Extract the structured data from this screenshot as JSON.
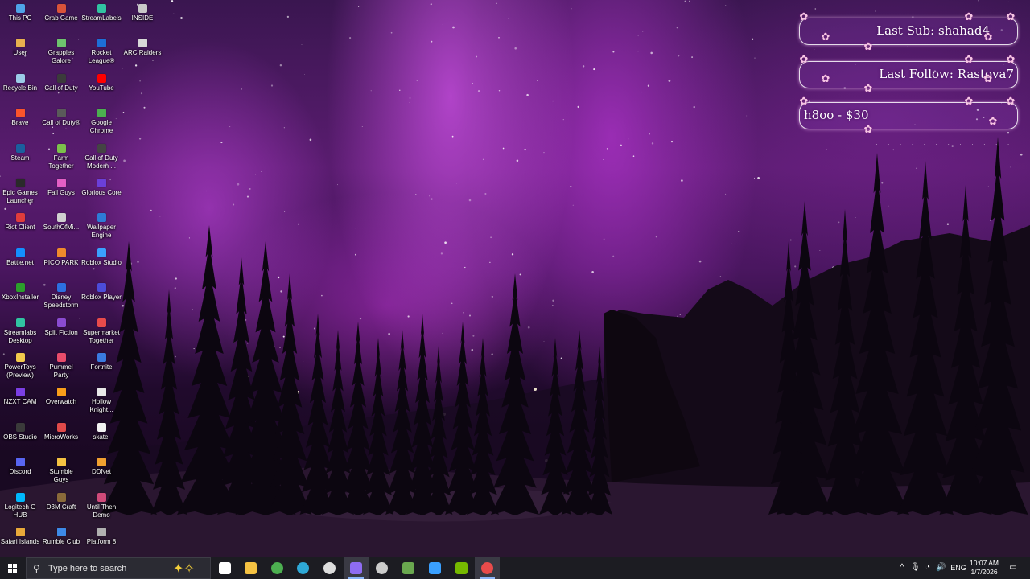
{
  "desktop": {
    "icons": [
      {
        "label": "This PC",
        "color": "#4fa3e8"
      },
      {
        "label": "User",
        "color": "#e8b04f"
      },
      {
        "label": "Recycle Bin",
        "color": "#9ccbe8"
      },
      {
        "label": "Brave",
        "color": "#fb542b"
      },
      {
        "label": "Steam",
        "color": "#1b5f9e"
      },
      {
        "label": "Epic Games Launcher",
        "color": "#2a2a2a"
      },
      {
        "label": "Riot Client",
        "color": "#e03c3c"
      },
      {
        "label": "Battle.net",
        "color": "#148eff"
      },
      {
        "label": "XboxInstaller",
        "color": "#2c9e2c"
      },
      {
        "label": "Streamlabs Desktop",
        "color": "#31c3a2"
      },
      {
        "label": "PowerToys (Preview)",
        "color": "#f2c94c"
      },
      {
        "label": "NZXT CAM",
        "color": "#7b3fe4"
      },
      {
        "label": "OBS Studio",
        "color": "#3a3a3a"
      },
      {
        "label": "Discord",
        "color": "#5865f2"
      },
      {
        "label": "Logitech G HUB",
        "color": "#00b8fc"
      },
      {
        "label": "Safari Islands",
        "color": "#e8a93a"
      },
      {
        "label": "Crab Game",
        "color": "#d9533a"
      },
      {
        "label": "Grapples Galore",
        "color": "#6ec26e"
      },
      {
        "label": "Call of Duty",
        "color": "#3b3b3b"
      },
      {
        "label": "Call of Duty®",
        "color": "#5a5a5a"
      },
      {
        "label": "Farm Together",
        "color": "#7cc14c"
      },
      {
        "label": "Fall Guys",
        "color": "#e35fc5"
      },
      {
        "label": "SouthOfMi...",
        "color": "#d0d0d0"
      },
      {
        "label": "PICO PARK",
        "color": "#f08a2c"
      },
      {
        "label": "Disney Speedstorm",
        "color": "#2d6fe0"
      },
      {
        "label": "Split Fiction",
        "color": "#8a4bd1"
      },
      {
        "label": "Pummel Party",
        "color": "#e84c6b"
      },
      {
        "label": "Overwatch",
        "color": "#f99e1a"
      },
      {
        "label": "MicroWorks",
        "color": "#e04a4a"
      },
      {
        "label": "Stumble Guys",
        "color": "#f5c242"
      },
      {
        "label": "D3M Craft",
        "color": "#8a6a3a"
      },
      {
        "label": "Rumble Club",
        "color": "#3d8ae8"
      },
      {
        "label": "StreamLabels",
        "color": "#31c3a2"
      },
      {
        "label": "Rocket League®",
        "color": "#1d6fd8"
      },
      {
        "label": "YouTube",
        "color": "#ff0000"
      },
      {
        "label": "Google Chrome",
        "color": "#4caf50"
      },
      {
        "label": "Call of Duty Modern ...",
        "color": "#444444"
      },
      {
        "label": "Glorious Core",
        "color": "#6b3fd9"
      },
      {
        "label": "Wallpaper Engine",
        "color": "#2e7bd6"
      },
      {
        "label": "Roblox Studio",
        "color": "#3aa0ff"
      },
      {
        "label": "Roblox Player",
        "color": "#4c4cd9"
      },
      {
        "label": "Supermarket Together",
        "color": "#e84b4b"
      },
      {
        "label": "Fortnite",
        "color": "#3a7be0"
      },
      {
        "label": "Hollow Knight...",
        "color": "#e8e8e8"
      },
      {
        "label": "skate.",
        "color": "#f2f2f2"
      },
      {
        "label": "DDNet",
        "color": "#f0a030"
      },
      {
        "label": "Until Then Demo",
        "color": "#d04a7a"
      },
      {
        "label": "Platform 8",
        "color": "#b0b0b0"
      },
      {
        "label": "INSIDE",
        "color": "#c8c8c8"
      },
      {
        "label": "ARC Raiders",
        "color": "#d8d8d8"
      }
    ]
  },
  "widgets": {
    "last_sub": "Last Sub: shahad4",
    "last_follow": "Last Follow: Rastova7",
    "donation": "h8oo - $30",
    "accent": "#f7c6e4"
  },
  "taskbar": {
    "search_placeholder": "Type here to search",
    "apps": [
      {
        "name": "start",
        "color": "#ffffff"
      },
      {
        "name": "task-view",
        "color": "#ffffff"
      },
      {
        "name": "file-explorer",
        "color": "#f5c242"
      },
      {
        "name": "chrome",
        "color": "#4caf50"
      },
      {
        "name": "edge",
        "color": "#2ea8d6"
      },
      {
        "name": "obs",
        "color": "#dddddd"
      },
      {
        "name": "discord",
        "color": "#8f6cf2"
      },
      {
        "name": "steam-or-tool",
        "color": "#cccccc"
      },
      {
        "name": "minecraft",
        "color": "#6aa84f"
      },
      {
        "name": "roblox",
        "color": "#3aa0ff"
      },
      {
        "name": "nvidia",
        "color": "#76b900"
      },
      {
        "name": "chrome-active",
        "color": "#e84b4b"
      }
    ],
    "language": "ENG",
    "time": "10:07 AM",
    "date": "1/7/2026"
  }
}
